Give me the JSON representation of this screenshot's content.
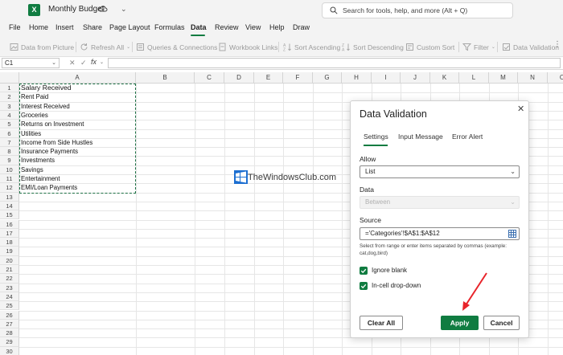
{
  "app": {
    "logo_letter": "X",
    "document_name": "Monthly Budget",
    "search_placeholder": "Search for tools, help, and more (Alt + Q)",
    "accent_color": "#107c41"
  },
  "ribbon_tabs": [
    "File",
    "Home",
    "Insert",
    "Share",
    "Page Layout",
    "Formulas",
    "Data",
    "Review",
    "View",
    "Help",
    "Draw"
  ],
  "active_tab": "Data",
  "ribbon_commands": {
    "data_from_picture": "Data from Picture",
    "refresh_all": "Refresh All",
    "queries_connections": "Queries & Connections",
    "workbook_links": "Workbook Links",
    "sort_ascending": "Sort Ascending",
    "sort_descending": "Sort Descending",
    "custom_sort": "Custom Sort",
    "filter": "Filter",
    "data_validation": "Data Validation"
  },
  "formula_bar": {
    "name_box": "C1",
    "fx": "fx",
    "value": ""
  },
  "columns": [
    "A",
    "B",
    "C",
    "D",
    "E",
    "F",
    "G",
    "H",
    "I",
    "J",
    "K",
    "L",
    "M",
    "N",
    "O"
  ],
  "row_numbers": [
    "1",
    "2",
    "3",
    "4",
    "5",
    "6",
    "7",
    "8",
    "9",
    "10",
    "11",
    "12",
    "13",
    "14",
    "15",
    "16",
    "17",
    "18",
    "19",
    "20",
    "21",
    "22",
    "23",
    "24",
    "25",
    "26",
    "27",
    "28",
    "29",
    "30"
  ],
  "column_a_values": [
    "Salary Received",
    "Rent Paid",
    "Interest Received",
    "Groceries",
    "Returns on Investment",
    "Utilities",
    "Income from Side Hustles",
    "Insurance Payments",
    "Investments",
    "Savings",
    "Entertainment",
    "EMI/Loan Payments"
  ],
  "watermark": "TheWindowsClub.com",
  "dialog": {
    "title": "Data Validation",
    "tabs": [
      "Settings",
      "Input Message",
      "Error Alert"
    ],
    "active_tab": "Settings",
    "allow_label": "Allow",
    "allow_value": "List",
    "data_label": "Data",
    "data_value": "Between",
    "source_label": "Source",
    "source_value": "='Categories'!$A$1:$A$12",
    "source_hint": "Select from range or enter items separated by commas (example: cat,dog,bird)",
    "ignore_blank_label": "Ignore blank",
    "ignore_blank_checked": true,
    "in_cell_dropdown_label": "In-cell drop-down",
    "in_cell_dropdown_checked": true,
    "clear_all_label": "Clear All",
    "apply_label": "Apply",
    "cancel_label": "Cancel"
  }
}
